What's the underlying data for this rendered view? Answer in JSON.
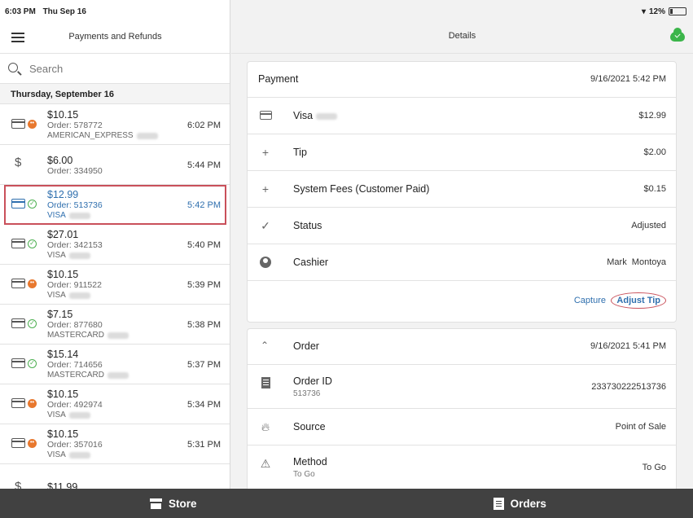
{
  "status_bar": {
    "time": "6:03 PM",
    "date": "Thu Sep 16",
    "battery": "12%"
  },
  "left_header": {
    "title": "Payments and Refunds"
  },
  "search": {
    "placeholder": "Search"
  },
  "date_group": "Thursday, September 16",
  "payments": [
    {
      "amount": "$10.15",
      "order": "Order: 578772",
      "method": "AMERICAN_EXPRESS",
      "time": "6:02 PM",
      "icon": "card-icon",
      "badge": "pending-badge"
    },
    {
      "amount": "$6.00",
      "order": "Order: 334950",
      "method": "",
      "time": "5:44 PM",
      "icon": "dollar-icon",
      "badge": ""
    },
    {
      "amount": "$12.99",
      "order": "Order: 513736",
      "method": "VISA",
      "time": "5:42 PM",
      "icon": "card-icon",
      "badge": "check-badge"
    },
    {
      "amount": "$27.01",
      "order": "Order: 342153",
      "method": "VISA",
      "time": "5:40 PM",
      "icon": "card-icon",
      "badge": "check-badge"
    },
    {
      "amount": "$10.15",
      "order": "Order: 911522",
      "method": "VISA",
      "time": "5:39 PM",
      "icon": "card-icon",
      "badge": "pending-badge"
    },
    {
      "amount": "$7.15",
      "order": "Order: 877680",
      "method": "MASTERCARD",
      "time": "5:38 PM",
      "icon": "card-icon",
      "badge": "check-badge"
    },
    {
      "amount": "$15.14",
      "order": "Order: 714656",
      "method": "MASTERCARD",
      "time": "5:37 PM",
      "icon": "card-icon",
      "badge": "check-badge"
    },
    {
      "amount": "$10.15",
      "order": "Order: 492974",
      "method": "VISA",
      "time": "5:34 PM",
      "icon": "card-icon",
      "badge": "pending-badge"
    },
    {
      "amount": "$10.15",
      "order": "Order: 357016",
      "method": "VISA",
      "time": "5:31 PM",
      "icon": "card-icon",
      "badge": "pending-badge"
    }
  ],
  "peek_amount": "$11.99",
  "right_header": {
    "title": "Details"
  },
  "payment_card": {
    "label": "Payment",
    "datetime": "9/16/2021 5:42 PM",
    "rows": [
      {
        "icon": "credit-card-icon",
        "label": "Visa",
        "value": "$12.99"
      },
      {
        "icon": "plus-icon",
        "label": "Tip",
        "value": "$2.00"
      },
      {
        "icon": "plus-icon",
        "label": "System Fees (Customer Paid)",
        "value": "$0.15"
      },
      {
        "icon": "check-icon",
        "label": "Status",
        "value": "Adjusted"
      },
      {
        "icon": "user-icon",
        "label": "Cashier",
        "value": "Mark  Montoya"
      }
    ],
    "capture_label": "Capture",
    "adjust_tip_label": "Adjust Tip"
  },
  "order_card": {
    "label": "Order",
    "datetime": "9/16/2021 5:41 PM",
    "rows": [
      {
        "icon": "document-icon",
        "label": "Order ID",
        "sub": "513736",
        "value": "233730222513736"
      },
      {
        "icon": "flame-icon",
        "label": "Source",
        "sub": "",
        "value": "Point of Sale"
      },
      {
        "icon": "warning-icon",
        "label": "Method",
        "sub": "To Go",
        "value": "To Go"
      }
    ]
  },
  "tabs": [
    {
      "label": "Store"
    },
    {
      "label": "Orders"
    }
  ],
  "colors": {
    "accent": "#2f6fae",
    "highlight": "#c9505a",
    "pending": "#e8782e",
    "success": "#4caf50",
    "tab_bar": "#414141"
  }
}
